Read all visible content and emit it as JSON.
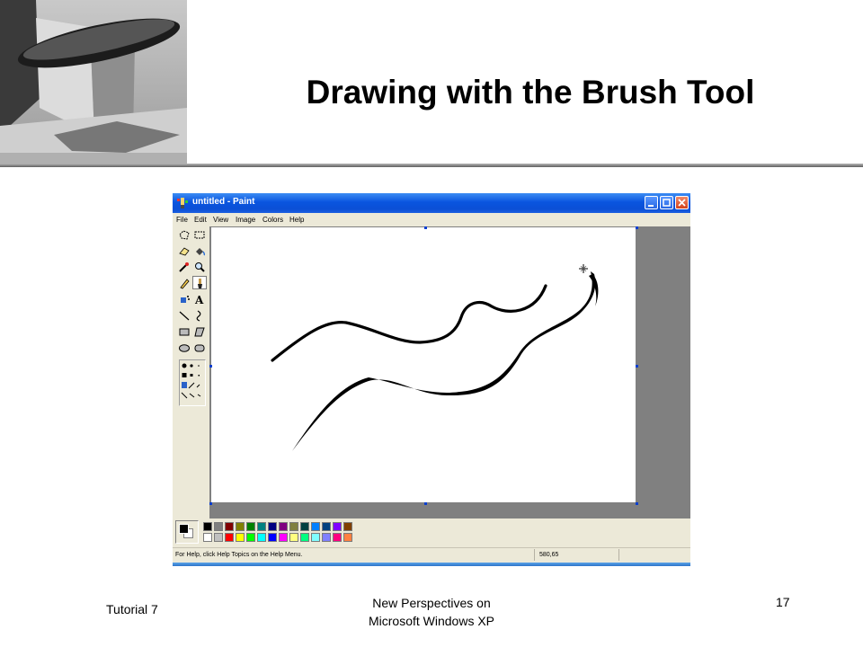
{
  "slide": {
    "title": "Drawing with the Brush Tool",
    "footer_left": "Tutorial 7",
    "footer_center_line1": "New Perspectives on",
    "footer_center_line2": "Microsoft Windows XP",
    "page_number": "17"
  },
  "window": {
    "title": "untitled - Paint",
    "app_icon": "paint-icon",
    "controls": [
      "minimize-icon",
      "maximize-icon",
      "close-icon"
    ]
  },
  "menu": {
    "items": [
      "File",
      "Edit",
      "View",
      "Image",
      "Colors",
      "Help"
    ]
  },
  "toolbox": {
    "tools": [
      "free-form-select-icon",
      "select-icon",
      "eraser-icon",
      "fill-with-color-icon",
      "pick-color-icon",
      "magnifier-icon",
      "pencil-icon",
      "brush-icon",
      "airbrush-icon",
      "text-icon",
      "line-icon",
      "curve-icon",
      "rectangle-icon",
      "polygon-icon",
      "ellipse-icon",
      "rounded-rectangle-icon"
    ],
    "selected_tool": "brush-icon"
  },
  "palette": {
    "foreground": "#000000",
    "background": "#ffffff",
    "colors_top": [
      "#000000",
      "#808080",
      "#800000",
      "#808000",
      "#008000",
      "#008080",
      "#000080",
      "#800080",
      "#808040",
      "#004040",
      "#0080ff",
      "#004080",
      "#8000ff",
      "#804000"
    ],
    "colors_bottom": [
      "#ffffff",
      "#c0c0c0",
      "#ff0000",
      "#ffff00",
      "#00ff00",
      "#00ffff",
      "#0000ff",
      "#ff00ff",
      "#ffff80",
      "#00ff80",
      "#80ffff",
      "#8080ff",
      "#ff0080",
      "#ff8040"
    ]
  },
  "status": {
    "help_text": "For Help, click Help Topics on the Help Menu.",
    "coordinates": "580,65"
  }
}
